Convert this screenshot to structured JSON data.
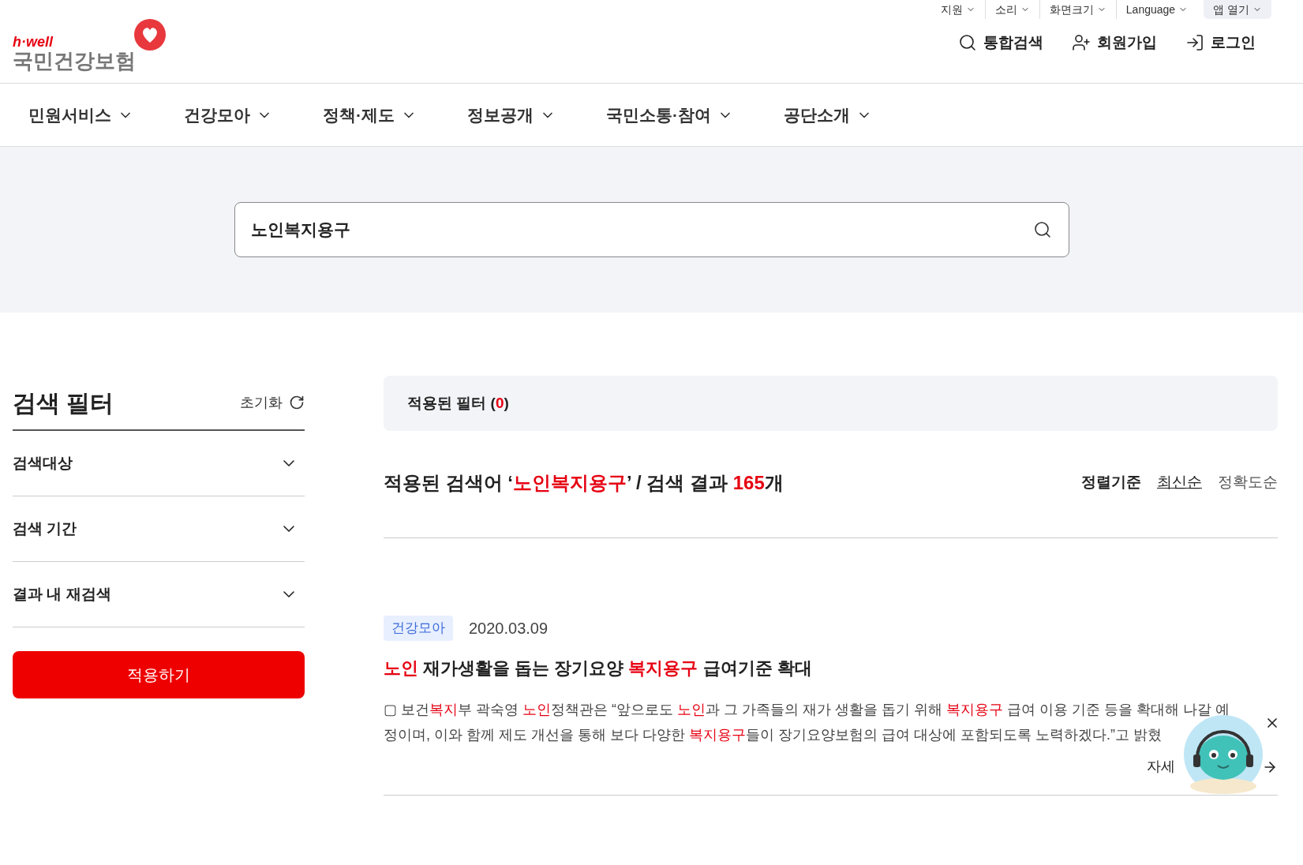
{
  "utility_links": [
    {
      "label": "지원",
      "highlighted": false
    },
    {
      "label": "소리",
      "highlighted": false
    },
    {
      "label": "화면크기",
      "highlighted": false
    },
    {
      "label": "Language",
      "highlighted": false
    },
    {
      "label": "앱 열기",
      "highlighted": true
    }
  ],
  "logo": {
    "tagline": "h·well",
    "name": "국민건강보험"
  },
  "header_actions": [
    {
      "kind": "search",
      "label": "통합검색"
    },
    {
      "kind": "join",
      "label": "회원가입"
    },
    {
      "kind": "login",
      "label": "로그인"
    }
  ],
  "nav": [
    {
      "label": "민원서비스"
    },
    {
      "label": "건강모아"
    },
    {
      "label": "정책·제도"
    },
    {
      "label": "정보공개"
    },
    {
      "label": "국민소통·참여"
    },
    {
      "label": "공단소개"
    }
  ],
  "search": {
    "value": "노인복지용구"
  },
  "filter": {
    "title": "검색 필터",
    "reset": "초기화",
    "sections": [
      {
        "label": "검색대상",
        "expanded": false
      },
      {
        "label": "검색 기간",
        "expanded": false
      },
      {
        "label": "결과 내 재검색",
        "expanded": false
      }
    ],
    "apply": "적용하기"
  },
  "applied_filters": "적용된 필터 (**0**)",
  "summary": "적용된 검색어 ‘**노인복지용구**’ / 검색 결과 **165**개",
  "sort": {
    "label": "정렬기준",
    "options": [
      {
        "label": "최신순",
        "selected": true
      },
      {
        "label": "정확도순",
        "selected": false
      }
    ]
  },
  "results": [
    {
      "tag": "건강모아",
      "date": "2020.03.09",
      "title": "**노인** 재가생활을 돕는 장기요양 **복지용구** 급여기준 확대",
      "body": "▢ 보건**복지**부 곽숙영 **노인**정책관은 “앞으로도 **노인**과 그 가족들의 재가 생활을 돕기 위해 **복지용구** 급여 이용 기준 등을 확대해 나갈 예정이며, 이와 함께 제도 개선을 통해 보다 다양한 **복지용구**들이 장기요양보험의 급여 대상에 포함되도록 노력하겠다.”고 밝혔",
      "more": "자세"
    }
  ]
}
